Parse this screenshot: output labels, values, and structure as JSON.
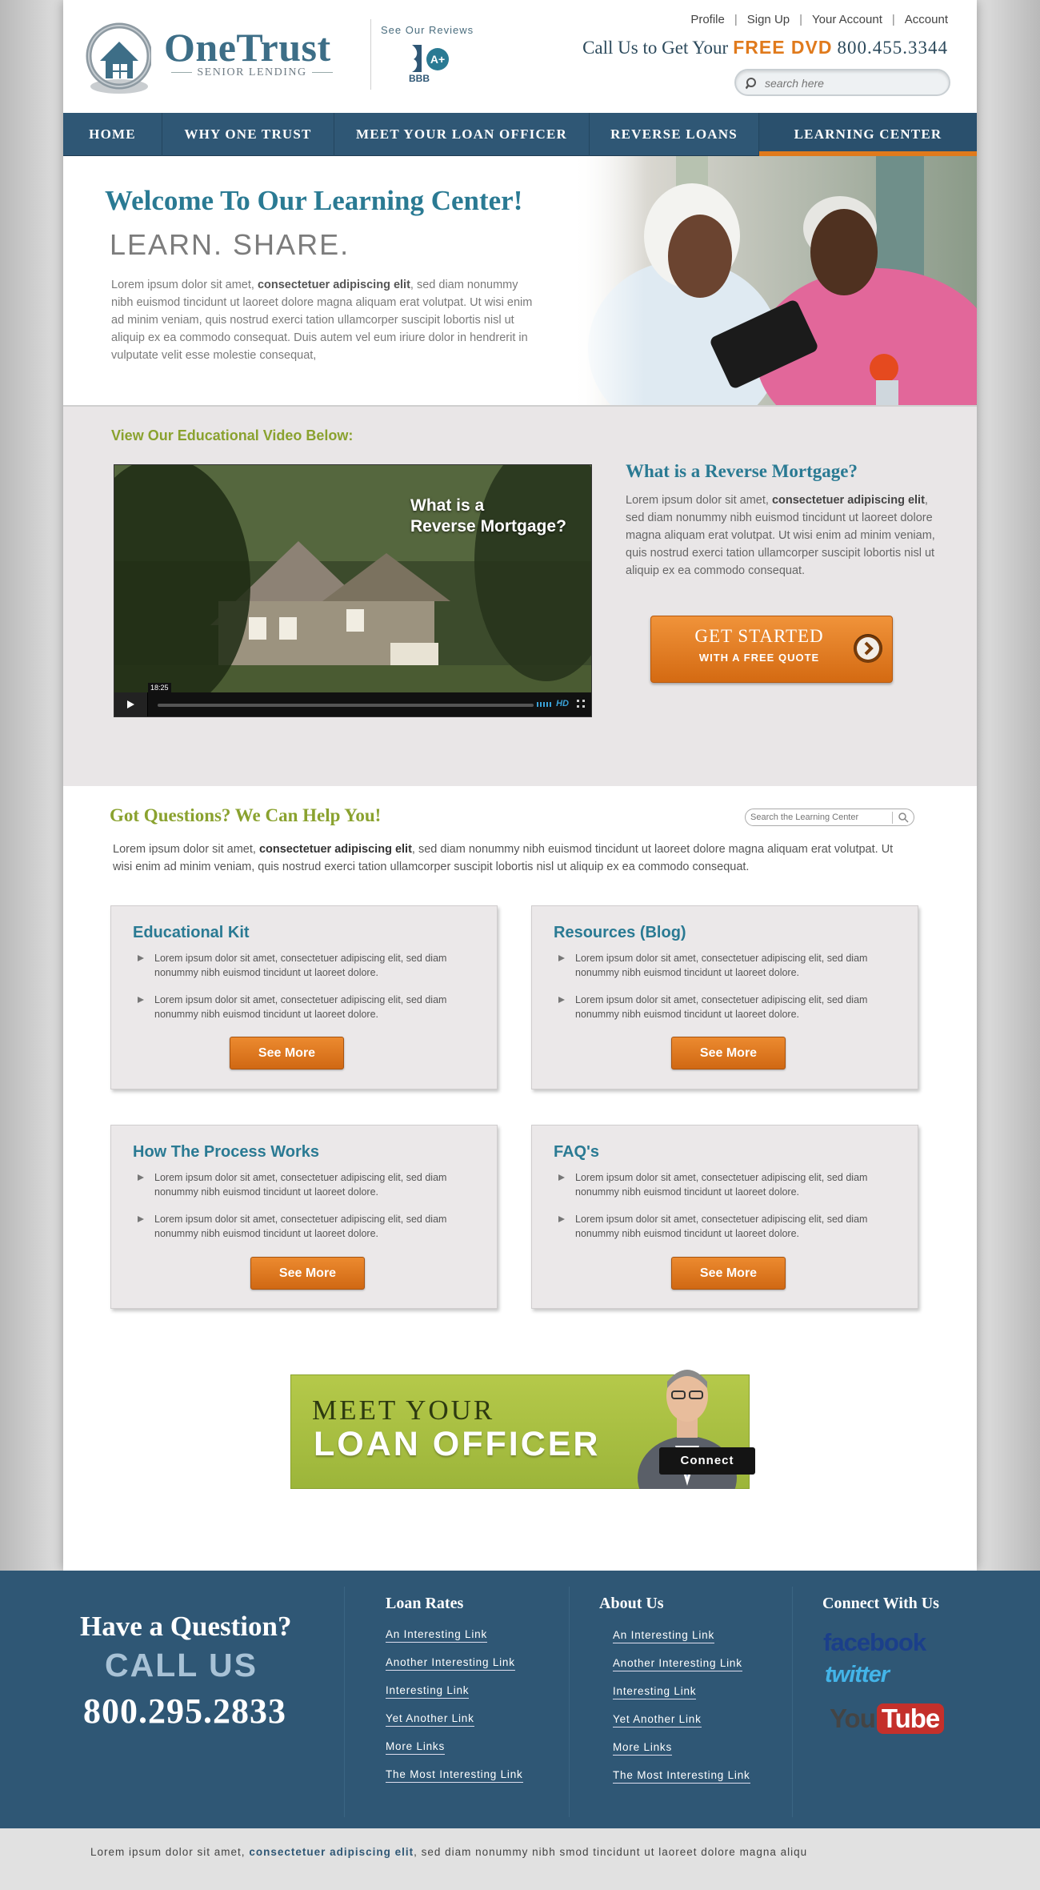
{
  "brand": {
    "name": "OneTrust",
    "tagline": "SENIOR LENDING",
    "reviews_label": "See Our Reviews",
    "bbb_label": "BBB",
    "bbb_grade": "A+"
  },
  "top_links": [
    "Profile",
    "Sign Up",
    "Your Account",
    "Account"
  ],
  "call": {
    "prefix": "Call Us to Get Your",
    "offer": "FREE DVD",
    "phone": "800.455.3344"
  },
  "search": {
    "placeholder": "search here"
  },
  "nav": [
    {
      "label": "HOME",
      "active": false
    },
    {
      "label": "WHY ONE TRUST",
      "active": false
    },
    {
      "label": "MEET YOUR LOAN OFFICER",
      "active": false
    },
    {
      "label": "REVERSE LOANS",
      "active": false
    },
    {
      "label": "LEARNING CENTER",
      "active": true
    }
  ],
  "hero": {
    "title": "Welcome To Our Learning Center!",
    "subtitle": "LEARN. SHARE.",
    "text_pre": "Lorem ipsum dolor sit amet, ",
    "text_bold": "consectetuer adipiscing elit",
    "text_post": ", sed diam nonummy nibh euismod tincidunt ut laoreet dolore magna aliquam erat volutpat. Ut wisi enim ad minim veniam, quis nostrud exerci tation ullamcorper suscipit lobortis nisl ut aliquip ex ea commodo consequat. Duis autem vel eum iriure dolor in hendrerit in vulputate velit esse molestie consequat,"
  },
  "video": {
    "label": "View Our Educational Video Below:",
    "caption_line1": "What is a",
    "caption_line2": "Reverse Mortgage?",
    "timecode": "18:25",
    "hd": "HD"
  },
  "reverse_mortgage": {
    "title": "What is a Reverse Mortgage?",
    "text_pre": "Lorem ipsum dolor sit amet, ",
    "text_bold": "consectetuer adipiscing elit",
    "text_post": ", sed diam nonummy nibh euismod tincidunt ut laoreet dolore magna aliquam erat volutpat. Ut wisi enim ad minim veniam, quis nostrud exerci tation ullamcorper suscipit lobortis nisl ut aliquip ex ea commodo consequat.",
    "cta_main": "GET STARTED",
    "cta_sub": "WITH A FREE QUOTE"
  },
  "questions": {
    "title": "Got Questions? We Can Help You!",
    "search_placeholder": "Search the Learning Center",
    "text_pre": "Lorem ipsum dolor sit amet, ",
    "text_bold": "consectetuer adipiscing elit",
    "text_post": ", sed diam nonummy nibh euismod tincidunt ut laoreet dolore magna aliquam erat volutpat. Ut wisi enim ad minim veniam, quis nostrud exerci tation ullamcorper suscipit lobortis nisl ut aliquip ex ea commodo consequat."
  },
  "cards": [
    {
      "title": "Educational Kit",
      "items": [
        "Lorem ipsum dolor sit amet, consectetuer adipiscing elit, sed diam nonummy nibh euismod tincidunt ut laoreet dolore.",
        "Lorem ipsum dolor sit amet, consectetuer adipiscing elit, sed diam nonummy nibh euismod tincidunt ut laoreet dolore."
      ],
      "button": "See More"
    },
    {
      "title": "Resources (Blog)",
      "items": [
        "Lorem ipsum dolor sit amet, consectetuer adipiscing elit, sed diam nonummy nibh euismod tincidunt ut laoreet dolore.",
        "Lorem ipsum dolor sit amet, consectetuer adipiscing elit, sed diam nonummy nibh euismod tincidunt ut laoreet dolore."
      ],
      "button": "See More"
    },
    {
      "title": "How The Process Works",
      "items": [
        "Lorem ipsum dolor sit amet, consectetuer adipiscing elit, sed diam nonummy nibh euismod tincidunt ut laoreet dolore.",
        "Lorem ipsum dolor sit amet, consectetuer adipiscing elit, sed diam nonummy nibh euismod tincidunt ut laoreet dolore."
      ],
      "button": "See More"
    },
    {
      "title": "FAQ's",
      "items": [
        "Lorem ipsum dolor sit amet, consectetuer adipiscing elit, sed diam nonummy nibh euismod tincidunt ut laoreet dolore.",
        "Lorem ipsum dolor sit amet, consectetuer adipiscing elit, sed diam nonummy nibh euismod tincidunt ut laoreet dolore."
      ],
      "button": "See More"
    }
  ],
  "loan_officer": {
    "line1": "MEET YOUR",
    "line2": "LOAN OFFICER",
    "connect": "Connect"
  },
  "footer": {
    "have_question": "Have a Question?",
    "call_us": "CALL US",
    "phone": "800.295.2833",
    "loan_rates": {
      "title": "Loan Rates",
      "links": [
        "An Interesting Link",
        "Another Interesting Link",
        "Interesting Link",
        "Yet Another Link",
        "More Links",
        "The Most Interesting Link"
      ]
    },
    "about": {
      "title": "About Us",
      "links": [
        "An Interesting Link",
        "Another Interesting Link",
        "Interesting Link",
        "Yet Another Link",
        "More Links",
        "The Most Interesting Link"
      ]
    },
    "connect": {
      "title": "Connect With Us",
      "facebook": "facebook",
      "twitter": "twitter",
      "youtube_you": "You",
      "youtube_tube": "Tube"
    }
  },
  "sub_footer": {
    "text_pre": "Lorem ipsum dolor sit amet, ",
    "text_bold": "consectetuer adipiscing elit",
    "text_post": ", sed diam nonummy nibh smod tincidunt ut laoreet dolore magna aliqu"
  },
  "colors": {
    "brand_blue": "#2f5775",
    "accent_orange": "#e07a1c",
    "heading_teal": "#2a7a93",
    "heading_green": "#8aa22f"
  }
}
